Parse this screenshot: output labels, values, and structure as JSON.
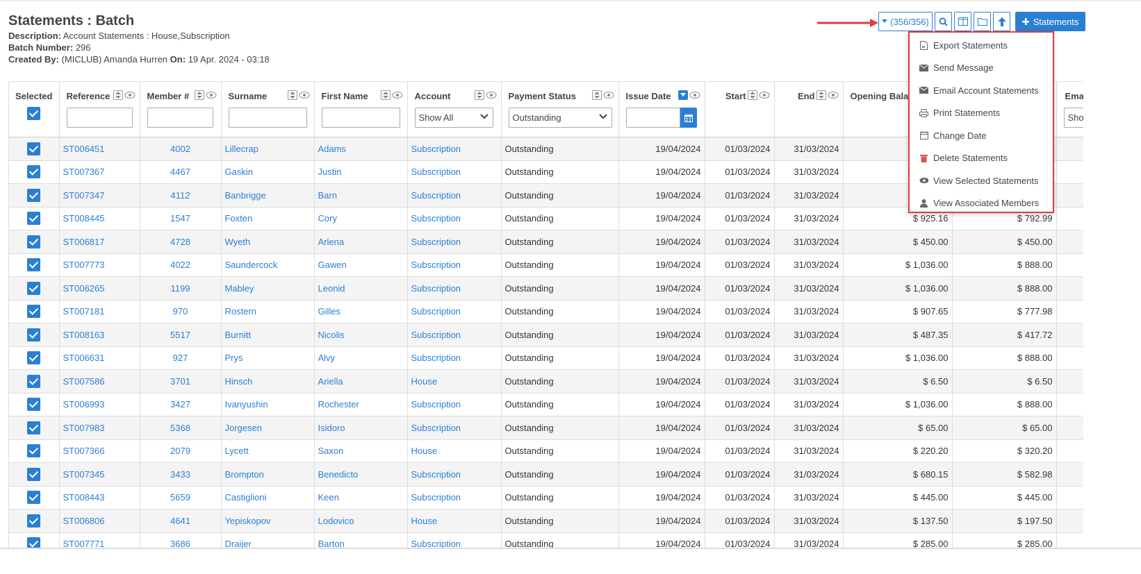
{
  "page": {
    "title": "Statements : Batch",
    "description_label": "Description:",
    "description_value": "Account Statements : House,Subscription",
    "batch_label": "Batch Number:",
    "batch_value": "296",
    "created_label": "Created By:",
    "created_value": "(MICLUB) Amanda Hurren",
    "on_label": "On:",
    "on_value": "19 Apr. 2024 - 03:18"
  },
  "toolbar": {
    "count_label": "(356/356)",
    "primary_label": "Statements",
    "accent": "#2a7fd4"
  },
  "menu": {
    "items": [
      {
        "label": "Export Statements",
        "icon": "export-file-icon"
      },
      {
        "label": "Send Message",
        "icon": "envelope-icon"
      },
      {
        "label": "Email Account Statements",
        "icon": "envelope-icon"
      },
      {
        "label": "Print Statements",
        "icon": "printer-icon"
      },
      {
        "label": "Change Date",
        "icon": "calendar-icon"
      },
      {
        "label": "Delete Statements",
        "icon": "trash-icon"
      },
      {
        "label": "View Selected Statements",
        "icon": "eye-icon"
      },
      {
        "label": "View Associated Members",
        "icon": "user-icon"
      }
    ]
  },
  "table": {
    "headers": {
      "selected": "Selected",
      "reference": "Reference",
      "member": "Member #",
      "surname": "Surname",
      "first_name": "First Name",
      "account": "Account",
      "payment_status": "Payment Status",
      "issue_date": "Issue Date",
      "start": "Start",
      "end": "End",
      "opening_balance": "Opening Bala",
      "email": "Ema"
    },
    "filters": {
      "account": "Show All",
      "payment_status": "Outstanding",
      "email": "Sho"
    },
    "rows": [
      {
        "ref": "ST006451",
        "member": "4002",
        "surname": "Lillecrap",
        "first": "Adams",
        "account": "Subscription",
        "status": "Outstanding",
        "issue": "19/04/2024",
        "start": "01/03/2024",
        "end": "31/03/2024",
        "opening": "",
        "closing": ""
      },
      {
        "ref": "ST007367",
        "member": "4467",
        "surname": "Gaskin",
        "first": "Justin",
        "account": "Subscription",
        "status": "Outstanding",
        "issue": "19/04/2024",
        "start": "01/03/2024",
        "end": "31/03/2024",
        "opening": "",
        "closing": ""
      },
      {
        "ref": "ST007347",
        "member": "4112",
        "surname": "Banbrigge",
        "first": "Barn",
        "account": "Subscription",
        "status": "Outstanding",
        "issue": "19/04/2024",
        "start": "01/03/2024",
        "end": "31/03/2024",
        "opening": "",
        "closing": ""
      },
      {
        "ref": "ST008445",
        "member": "1547",
        "surname": "Foxten",
        "first": "Cory",
        "account": "Subscription",
        "status": "Outstanding",
        "issue": "19/04/2024",
        "start": "01/03/2024",
        "end": "31/03/2024",
        "opening": "$ 925.16",
        "closing": "$ 792.99"
      },
      {
        "ref": "ST006817",
        "member": "4728",
        "surname": "Wyeth",
        "first": "Arlena",
        "account": "Subscription",
        "status": "Outstanding",
        "issue": "19/04/2024",
        "start": "01/03/2024",
        "end": "31/03/2024",
        "opening": "$ 450.00",
        "closing": "$ 450.00"
      },
      {
        "ref": "ST007773",
        "member": "4022",
        "surname": "Saundercock",
        "first": "Gawen",
        "account": "Subscription",
        "status": "Outstanding",
        "issue": "19/04/2024",
        "start": "01/03/2024",
        "end": "31/03/2024",
        "opening": "$ 1,036.00",
        "closing": "$ 888.00"
      },
      {
        "ref": "ST006265",
        "member": "1199",
        "surname": "Mabley",
        "first": "Leonid",
        "account": "Subscription",
        "status": "Outstanding",
        "issue": "19/04/2024",
        "start": "01/03/2024",
        "end": "31/03/2024",
        "opening": "$ 1,036.00",
        "closing": "$ 888.00"
      },
      {
        "ref": "ST007181",
        "member": "970",
        "surname": "Rostern",
        "first": "Gilles",
        "account": "Subscription",
        "status": "Outstanding",
        "issue": "19/04/2024",
        "start": "01/03/2024",
        "end": "31/03/2024",
        "opening": "$ 907.65",
        "closing": "$ 777.98"
      },
      {
        "ref": "ST008163",
        "member": "5517",
        "surname": "Burnitt",
        "first": "Nicolis",
        "account": "Subscription",
        "status": "Outstanding",
        "issue": "19/04/2024",
        "start": "01/03/2024",
        "end": "31/03/2024",
        "opening": "$ 487.35",
        "closing": "$ 417.72"
      },
      {
        "ref": "ST006631",
        "member": "927",
        "surname": "Prys",
        "first": "Alvy",
        "account": "Subscription",
        "status": "Outstanding",
        "issue": "19/04/2024",
        "start": "01/03/2024",
        "end": "31/03/2024",
        "opening": "$ 1,036.00",
        "closing": "$ 888.00"
      },
      {
        "ref": "ST007586",
        "member": "3701",
        "surname": "Hinsch",
        "first": "Ariella",
        "account": "House",
        "status": "Outstanding",
        "issue": "19/04/2024",
        "start": "01/03/2024",
        "end": "31/03/2024",
        "opening": "$ 6.50",
        "closing": "$ 6.50"
      },
      {
        "ref": "ST006993",
        "member": "3427",
        "surname": "Ivanyushin",
        "first": "Rochester",
        "account": "Subscription",
        "status": "Outstanding",
        "issue": "19/04/2024",
        "start": "01/03/2024",
        "end": "31/03/2024",
        "opening": "$ 1,036.00",
        "closing": "$ 888.00"
      },
      {
        "ref": "ST007983",
        "member": "5368",
        "surname": "Jorgesen",
        "first": "Isidoro",
        "account": "Subscription",
        "status": "Outstanding",
        "issue": "19/04/2024",
        "start": "01/03/2024",
        "end": "31/03/2024",
        "opening": "$ 65.00",
        "closing": "$ 65.00"
      },
      {
        "ref": "ST007366",
        "member": "2079",
        "surname": "Lycett",
        "first": "Saxon",
        "account": "House",
        "status": "Outstanding",
        "issue": "19/04/2024",
        "start": "01/03/2024",
        "end": "31/03/2024",
        "opening": "$ 220.20",
        "closing": "$ 320.20"
      },
      {
        "ref": "ST007345",
        "member": "3433",
        "surname": "Brompton",
        "first": "Benedicto",
        "account": "Subscription",
        "status": "Outstanding",
        "issue": "19/04/2024",
        "start": "01/03/2024",
        "end": "31/03/2024",
        "opening": "$ 680.15",
        "closing": "$ 582.98"
      },
      {
        "ref": "ST008443",
        "member": "5659",
        "surname": "Castiglioni",
        "first": "Keen",
        "account": "Subscription",
        "status": "Outstanding",
        "issue": "19/04/2024",
        "start": "01/03/2024",
        "end": "31/03/2024",
        "opening": "$ 445.00",
        "closing": "$ 445.00"
      },
      {
        "ref": "ST006806",
        "member": "4641",
        "surname": "Yepiskopov",
        "first": "Lodovico",
        "account": "House",
        "status": "Outstanding",
        "issue": "19/04/2024",
        "start": "01/03/2024",
        "end": "31/03/2024",
        "opening": "$ 137.50",
        "closing": "$ 197.50"
      },
      {
        "ref": "ST007771",
        "member": "3686",
        "surname": "Draijer",
        "first": "Barton",
        "account": "Subscription",
        "status": "Outstanding",
        "issue": "19/04/2024",
        "start": "01/03/2024",
        "end": "31/03/2024",
        "opening": "$ 285.00",
        "closing": "$ 285.00"
      }
    ]
  }
}
